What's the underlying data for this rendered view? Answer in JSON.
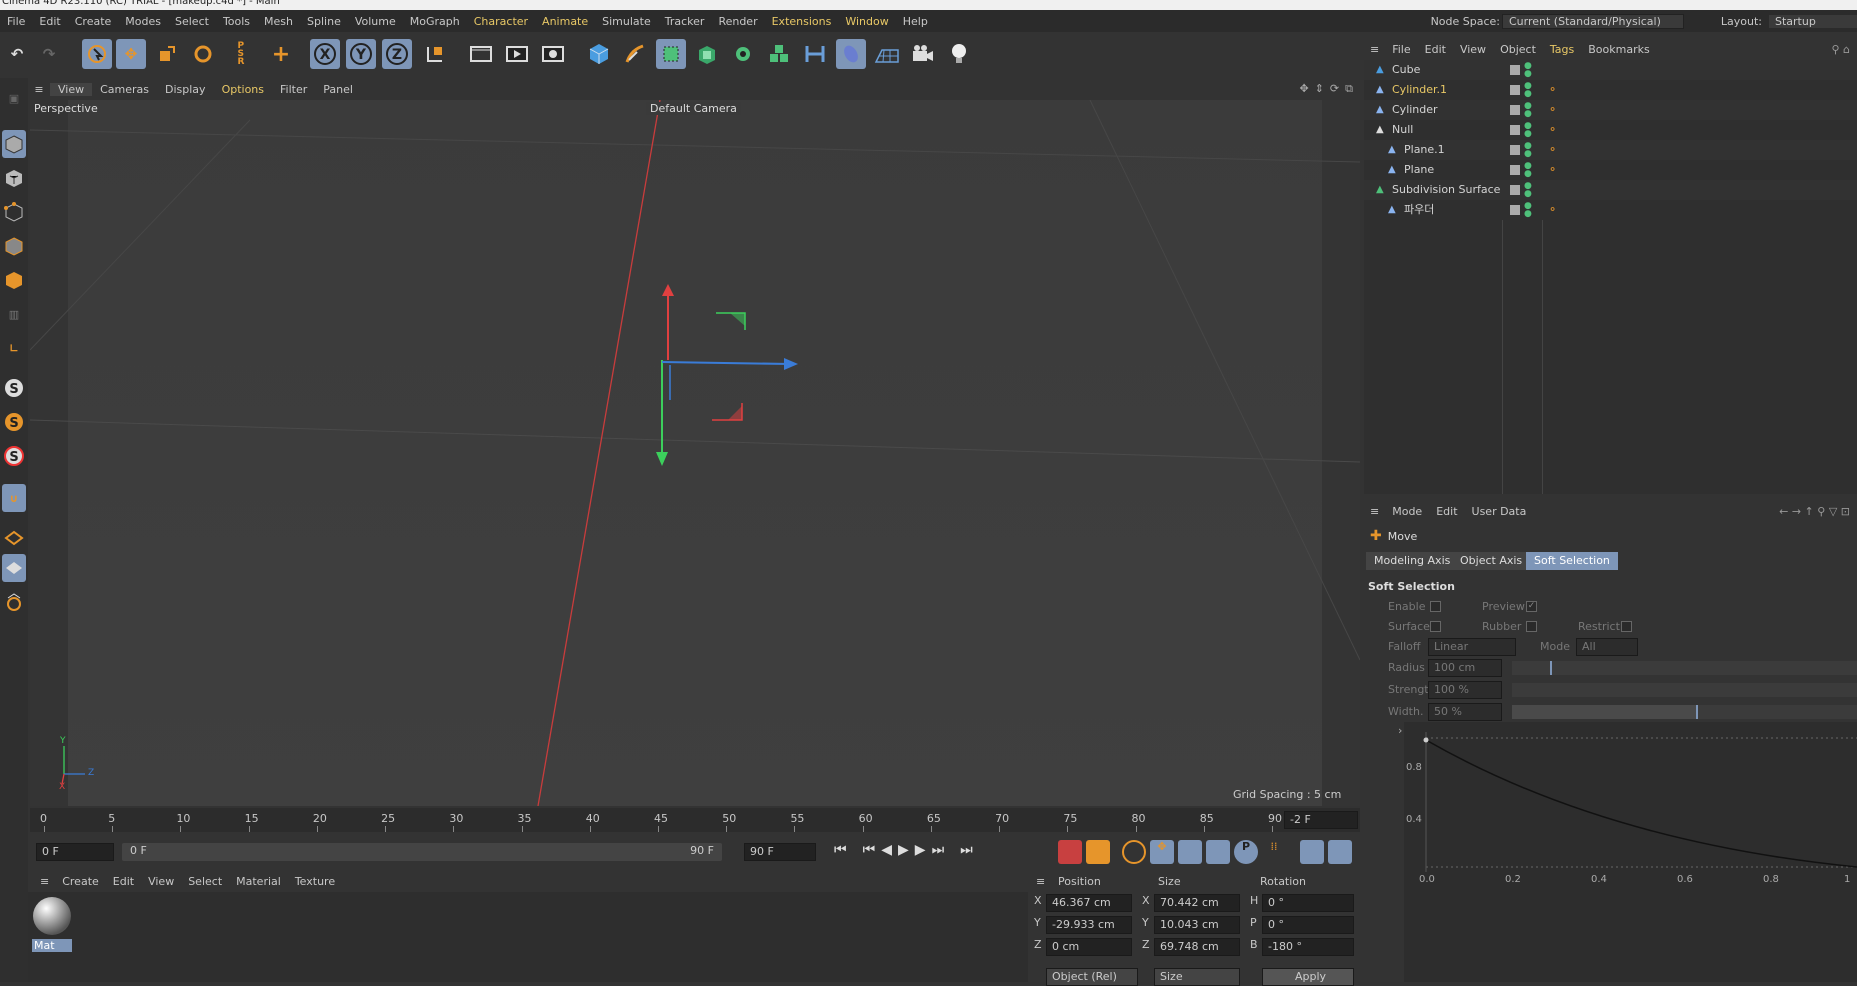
{
  "app": {
    "title": "Cinema 4D R23.110 (RC) TRIAL - [makeup.c4d *] - Main"
  },
  "menu": [
    "File",
    "Edit",
    "Create",
    "Modes",
    "Select",
    "Tools",
    "Mesh",
    "Spline",
    "Volume",
    "MoGraph",
    "Character",
    "Animate",
    "Simulate",
    "Tracker",
    "Render",
    "Extensions",
    "Window",
    "Help"
  ],
  "node_space": {
    "label": "Node Space:",
    "value": "Current (Standard/Physical)"
  },
  "layout": {
    "label": "Layout:",
    "value": "Startup"
  },
  "viewport_menu": [
    "View",
    "Cameras",
    "Display",
    "Options",
    "Filter",
    "Panel"
  ],
  "viewport": {
    "name": "Perspective",
    "camera": "Default Camera",
    "grid_spacing": "Grid Spacing : 5 cm",
    "axis_y": "Y",
    "axis_z": "Z",
    "axis_x": "X"
  },
  "timeline": {
    "ticks": [
      "0",
      "5",
      "10",
      "15",
      "20",
      "25",
      "30",
      "35",
      "40",
      "45",
      "50",
      "55",
      "60",
      "65",
      "70",
      "75",
      "80",
      "85",
      "90"
    ],
    "current_frame": "-2 F",
    "start": "0 F",
    "range_start": "0 F",
    "range_end": "90 F",
    "end": "90 F"
  },
  "material_manager": {
    "menu": [
      "Create",
      "Edit",
      "View",
      "Select",
      "Material",
      "Texture"
    ],
    "materials": [
      {
        "name": "Mat"
      }
    ]
  },
  "coordinates": {
    "headers": [
      "Position",
      "Size",
      "Rotation"
    ],
    "rows": [
      {
        "axis": "X",
        "pos": "46.367 cm",
        "size_axis": "X",
        "size": "70.442 cm",
        "rot_axis": "H",
        "rot": "0 °"
      },
      {
        "axis": "Y",
        "pos": "-29.933 cm",
        "size_axis": "Y",
        "size": "10.043 cm",
        "rot_axis": "P",
        "rot": "0 °"
      },
      {
        "axis": "Z",
        "pos": "0 cm",
        "size_axis": "Z",
        "size": "69.748 cm",
        "rot_axis": "B",
        "rot": "-180 °"
      }
    ],
    "mode": "Object (Rel)",
    "size_mode": "Size",
    "apply": "Apply"
  },
  "object_manager": {
    "menu": [
      "File",
      "Edit",
      "View",
      "Object",
      "Tags",
      "Bookmarks"
    ],
    "objects": [
      {
        "name": "Cube",
        "indent": 0,
        "highlight": false
      },
      {
        "name": "Cylinder.1",
        "indent": 0,
        "highlight": true
      },
      {
        "name": "Cylinder",
        "indent": 0,
        "highlight": false
      },
      {
        "name": "Null",
        "indent": 0,
        "highlight": false
      },
      {
        "name": "Plane.1",
        "indent": 1,
        "highlight": false
      },
      {
        "name": "Plane",
        "indent": 1,
        "highlight": false
      },
      {
        "name": "Subdivision Surface",
        "indent": 0,
        "highlight": false
      },
      {
        "name": "파우더",
        "indent": 1,
        "highlight": false
      }
    ]
  },
  "attributes": {
    "menu": [
      "Mode",
      "Edit",
      "User Data"
    ],
    "tool": "Move",
    "tabs": [
      "Modeling Axis",
      "Object Axis",
      "Soft Selection"
    ],
    "section": "Soft Selection",
    "labels": {
      "enable": "Enable",
      "preview": "Preview",
      "surface": "Surface",
      "rubber": "Rubber",
      "restrict": "Restrict",
      "falloff": "Falloff",
      "falloff_value": "Linear",
      "mode": "Mode",
      "mode_value": "All",
      "radius": "Radius",
      "radius_value": "100 cm",
      "strength": "Strength",
      "strength_value": "100 %",
      "width": "Width. .",
      "width_value": "50 %"
    },
    "graph": {
      "y_ticks": [
        "0.8",
        "0.4"
      ],
      "x_ticks": [
        "0.0",
        "0.2",
        "0.4",
        "0.6",
        "0.8",
        "1"
      ]
    }
  }
}
